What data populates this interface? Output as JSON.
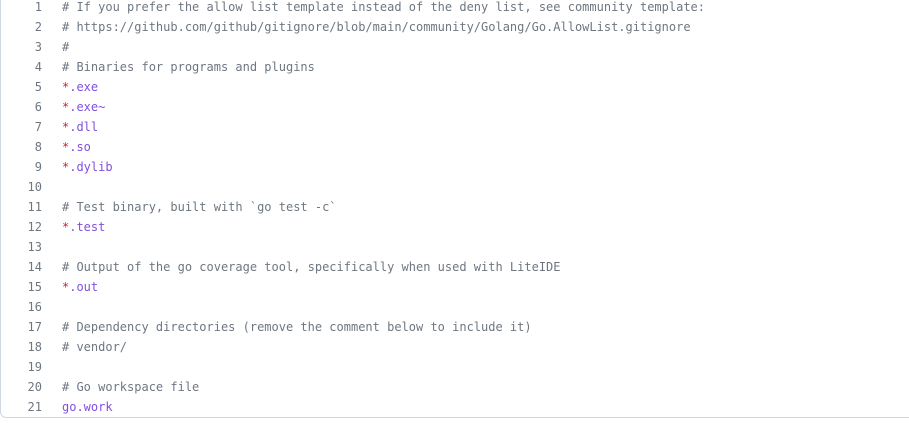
{
  "colors": {
    "line_number": "#6e7781",
    "comment": "#6e7781",
    "glob_star": "#cf222e",
    "glob_pattern": "#8250df",
    "border": "#d0d7de"
  },
  "lines": [
    {
      "n": "1",
      "tokens": [
        {
          "t": "comment",
          "v": "# If you prefer the allow list template instead of the deny list, see community template:"
        }
      ]
    },
    {
      "n": "2",
      "tokens": [
        {
          "t": "comment",
          "v": "# https://github.com/github/gitignore/blob/main/community/Golang/Go.AllowList.gitignore"
        }
      ]
    },
    {
      "n": "3",
      "tokens": [
        {
          "t": "comment",
          "v": "#"
        }
      ]
    },
    {
      "n": "4",
      "tokens": [
        {
          "t": "comment",
          "v": "# Binaries for programs and plugins"
        }
      ]
    },
    {
      "n": "5",
      "tokens": [
        {
          "t": "star",
          "v": "*"
        },
        {
          "t": "pattern",
          "v": ".exe"
        }
      ]
    },
    {
      "n": "6",
      "tokens": [
        {
          "t": "star",
          "v": "*"
        },
        {
          "t": "pattern",
          "v": ".exe~"
        }
      ]
    },
    {
      "n": "7",
      "tokens": [
        {
          "t": "star",
          "v": "*"
        },
        {
          "t": "pattern",
          "v": ".dll"
        }
      ]
    },
    {
      "n": "8",
      "tokens": [
        {
          "t": "star",
          "v": "*"
        },
        {
          "t": "pattern",
          "v": ".so"
        }
      ]
    },
    {
      "n": "9",
      "tokens": [
        {
          "t": "star",
          "v": "*"
        },
        {
          "t": "pattern",
          "v": ".dylib"
        }
      ]
    },
    {
      "n": "10",
      "tokens": []
    },
    {
      "n": "11",
      "tokens": [
        {
          "t": "comment",
          "v": "# Test binary, built with `go test -c`"
        }
      ]
    },
    {
      "n": "12",
      "tokens": [
        {
          "t": "star",
          "v": "*"
        },
        {
          "t": "pattern",
          "v": ".test"
        }
      ]
    },
    {
      "n": "13",
      "tokens": []
    },
    {
      "n": "14",
      "tokens": [
        {
          "t": "comment",
          "v": "# Output of the go coverage tool, specifically when used with LiteIDE"
        }
      ]
    },
    {
      "n": "15",
      "tokens": [
        {
          "t": "star",
          "v": "*"
        },
        {
          "t": "pattern",
          "v": ".out"
        }
      ]
    },
    {
      "n": "16",
      "tokens": []
    },
    {
      "n": "17",
      "tokens": [
        {
          "t": "comment",
          "v": "# Dependency directories (remove the comment below to include it)"
        }
      ]
    },
    {
      "n": "18",
      "tokens": [
        {
          "t": "comment",
          "v": "# vendor/"
        }
      ]
    },
    {
      "n": "19",
      "tokens": []
    },
    {
      "n": "20",
      "tokens": [
        {
          "t": "comment",
          "v": "# Go workspace file"
        }
      ]
    },
    {
      "n": "21",
      "tokens": [
        {
          "t": "pattern",
          "v": "go.work"
        }
      ]
    }
  ]
}
